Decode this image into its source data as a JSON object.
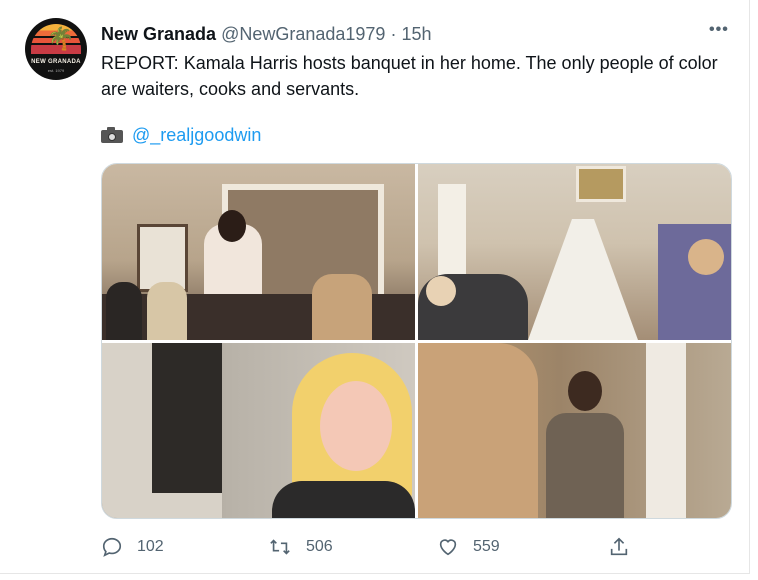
{
  "account": {
    "display_name": "New Granada",
    "handle": "@NewGranada1979",
    "separator": "·",
    "time": "15h",
    "avatar_text": "NEW GRANADA",
    "avatar_sub": "est. 1979"
  },
  "tweet": {
    "text": "REPORT: Kamala Harris hosts banquet in her home. The only people of color are waiters, cooks and servants.",
    "credit_icon": "camera-icon",
    "credit_mention": "@_realjgoodwin"
  },
  "media": [
    {
      "position": "top-left",
      "description_icon": "photo"
    },
    {
      "position": "top-right",
      "description_icon": "photo"
    },
    {
      "position": "bottom-left",
      "description_icon": "photo"
    },
    {
      "position": "bottom-right",
      "description_icon": "photo"
    }
  ],
  "actions": {
    "reply_count": "102",
    "retweet_count": "506",
    "like_count": "559",
    "more_label": "•••"
  },
  "colors": {
    "text": "#0f1419",
    "secondary": "#536471",
    "link": "#1d9bf0",
    "border": "#cfd9de"
  }
}
